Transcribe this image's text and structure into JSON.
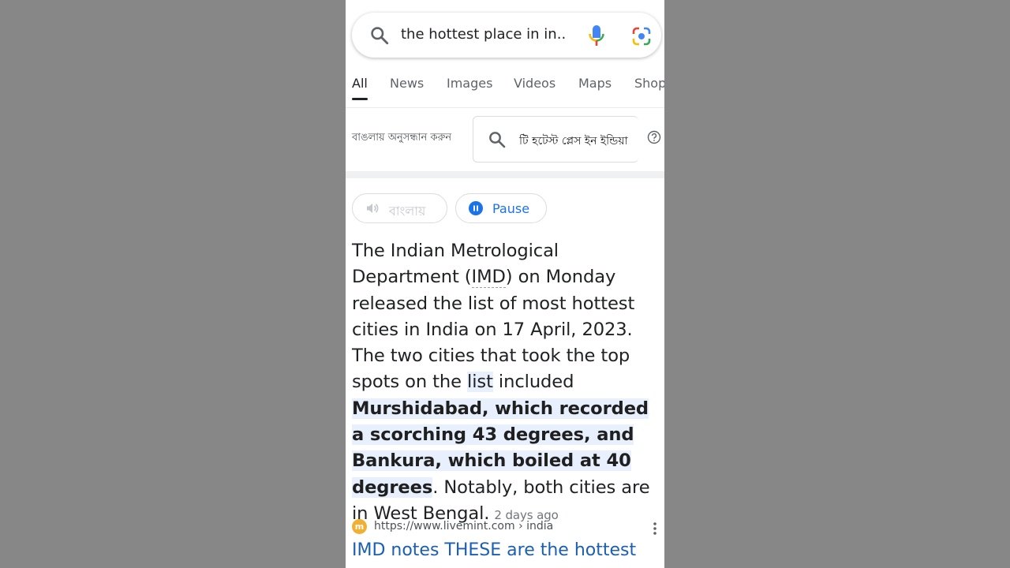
{
  "search": {
    "query": "the hottest place in in..."
  },
  "tabs": [
    {
      "label": "All",
      "active": true
    },
    {
      "label": "News"
    },
    {
      "label": "Images"
    },
    {
      "label": "Videos"
    },
    {
      "label": "Maps"
    },
    {
      "label": "Shop"
    }
  ],
  "bengali": {
    "label": "বাঙলায় অনুসন্ধান করুন",
    "query": "টি হটেস্ট প্লেস ইন ইন্ডিয়া"
  },
  "audio": {
    "lang_label": "বাংলায়",
    "pause_label": "Pause"
  },
  "snippet": {
    "part1": "The Indian Metrological Department (",
    "imd": "IMD",
    "part2": ") on Monday released the list of most hottest cities in India on 17 April, 2023. The two cities that took the top spots on the ",
    "list_word": "list",
    "part3": " included ",
    "highlight": "Murshidabad, which recorded a scorching 43 degrees, and Bankura, which boiled at 40 degrees",
    "part4": ". Notably, both cities are in West Bengal.",
    "date": "2 days ago"
  },
  "result": {
    "favicon_letter": "m",
    "url": "https://www.livemint.com › india",
    "title": "IMD notes THESE are the hottest"
  },
  "colors": {
    "link": "#1a5fb4",
    "highlight": "#e8f0fe",
    "background": "#878787"
  }
}
